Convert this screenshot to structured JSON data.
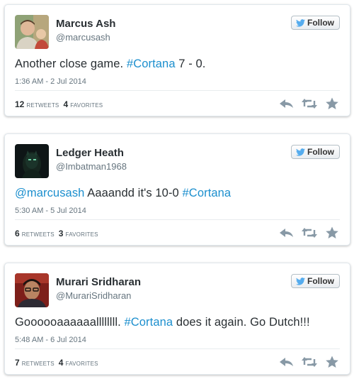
{
  "colors": {
    "link": "#1c8fce",
    "icon": "#8899a6",
    "twitter_blue": "#55acee"
  },
  "icons": {
    "follow": "twitter-bird-icon",
    "reply": "reply-icon",
    "retweet": "retweet-icon",
    "favorite": "favorite-star-icon"
  },
  "tweets": [
    {
      "display_name": "Marcus Ash",
      "handle": "@marcusash",
      "follow_label": "Follow",
      "text_parts": {
        "a": "Another close game. ",
        "b": "#Cortana",
        "c": " 7 - 0."
      },
      "timestamp": "1:36 AM - 2 Jul 2014",
      "retweets_count": "12",
      "retweets_label": "RETWEETS",
      "favorites_count": "4",
      "favorites_label": "FAVORITES"
    },
    {
      "display_name": "Ledger Heath",
      "handle": "@Imbatman1968",
      "follow_label": "Follow",
      "text_parts": {
        "a": "@marcusash",
        "b": " Aaaandd it's 10-0 ",
        "c": "#Cortana"
      },
      "timestamp": "5:30 AM - 5 Jul 2014",
      "retweets_count": "6",
      "retweets_label": "RETWEETS",
      "favorites_count": "3",
      "favorites_label": "FAVORITES"
    },
    {
      "display_name": "Murari Sridharan",
      "handle": "@MurariSridharan",
      "follow_label": "Follow",
      "text_parts": {
        "a": "Goooooaaaaaallllllll.  ",
        "b": "#Cortana",
        "c": " does it again. Go Dutch!!!"
      },
      "timestamp": "5:48 AM - 6 Jul 2014",
      "retweets_count": "7",
      "retweets_label": "RETWEETS",
      "favorites_count": "4",
      "favorites_label": "FAVORITES"
    }
  ]
}
